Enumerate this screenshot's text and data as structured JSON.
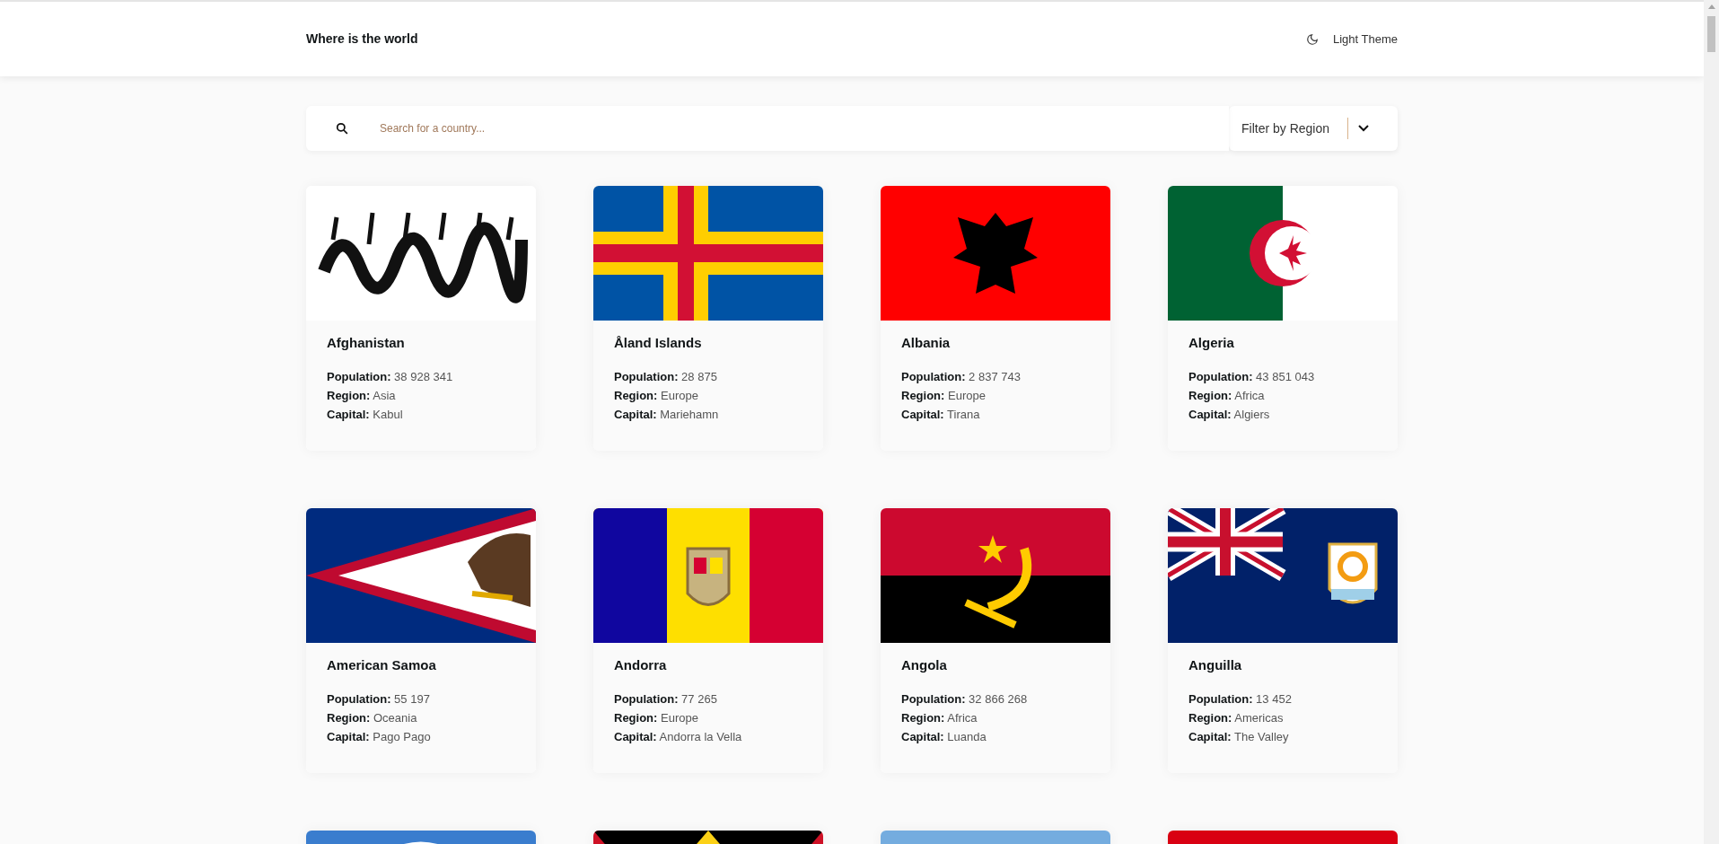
{
  "header": {
    "title": "Where is the world",
    "theme_toggle": "Light Theme"
  },
  "search": {
    "placeholder": "Search for a country..."
  },
  "filter": {
    "label": "Filter by Region"
  },
  "countries": [
    {
      "kind": "afghanistan",
      "name": "Afghanistan",
      "details": [
        "**Population:** 38 928 341",
        "**Region:** Asia",
        "**Capital:** Kabul"
      ]
    },
    {
      "kind": "aland",
      "name": "Åland Islands",
      "details": [
        "**Population:** 28 875",
        "**Region:** Europe",
        "**Capital:** Mariehamn"
      ]
    },
    {
      "kind": "albania",
      "name": "Albania",
      "details": [
        "**Population:** 2 837 743",
        "**Region:** Europe",
        "**Capital:** Tirana"
      ]
    },
    {
      "kind": "algeria",
      "name": "Algeria",
      "details": [
        "**Population:** 43 851 043",
        "**Region:** Africa",
        "**Capital:** Algiers"
      ]
    },
    {
      "kind": "american_samoa",
      "name": "American Samoa",
      "details": [
        "**Population:** 55 197",
        "**Region:** Oceania",
        "**Capital:** Pago Pago"
      ]
    },
    {
      "kind": "andorra",
      "name": "Andorra",
      "details": [
        "**Population:** 77 265",
        "**Region:** Europe",
        "**Capital:** Andorra la Vella"
      ]
    },
    {
      "kind": "angola",
      "name": "Angola",
      "details": [
        "**Population:** 32 866 268",
        "**Region:** Africa",
        "**Capital:** Luanda"
      ]
    },
    {
      "kind": "anguilla",
      "name": "Anguilla",
      "details": [
        "**Population:** 13 452",
        "**Region:** Americas",
        "**Capital:** The Valley"
      ]
    },
    {
      "kind": "antarctica"
    },
    {
      "kind": "antigua"
    },
    {
      "kind": "argentina"
    },
    {
      "kind": "armenia"
    }
  ]
}
